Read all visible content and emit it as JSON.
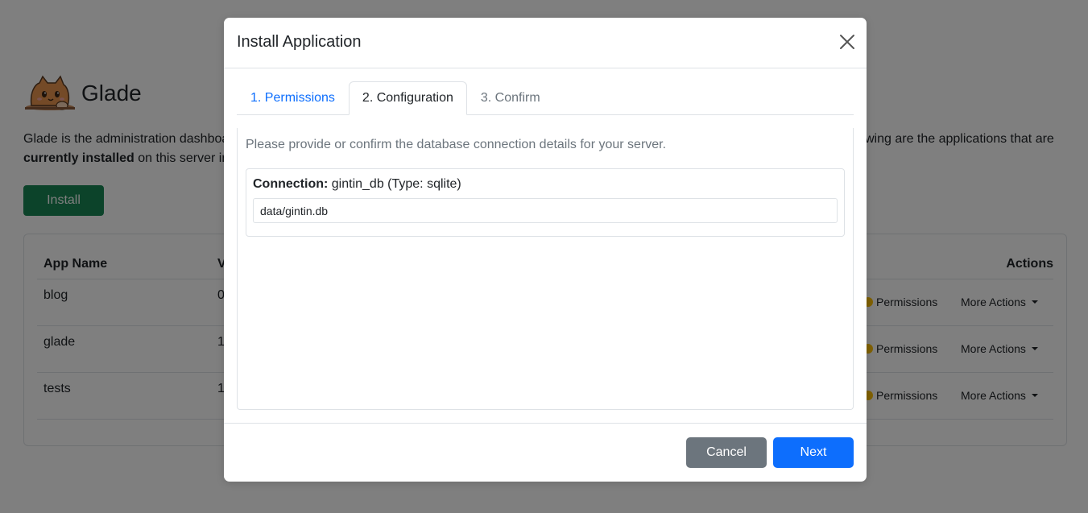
{
  "brand": {
    "title": "Glade",
    "logo_icon": "cat-logo-icon"
  },
  "intro": {
    "text_left": "Glade is the administration dashboa",
    "text_right": "wing are the applications that are",
    "bold_text": "currently installed",
    "text_line2_rest": " on this server ins"
  },
  "install_button_label": "Install",
  "apps_table": {
    "headers": {
      "name": "App Name",
      "version": "V",
      "actions": "Actions"
    },
    "rows": [
      {
        "name": "blog",
        "version": "0",
        "permissions_label": "Permissions",
        "more_label": "More Actions"
      },
      {
        "name": "glade",
        "version": "1",
        "permissions_label": "Permissions",
        "more_label": "More Actions"
      },
      {
        "name": "tests",
        "version": "1",
        "permissions_label": "Permissions",
        "more_label": "More Actions"
      }
    ]
  },
  "modal": {
    "title": "Install Application",
    "close_icon": "close-icon",
    "tabs": [
      {
        "label": "1. Permissions",
        "state": "link"
      },
      {
        "label": "2. Configuration",
        "state": "active"
      },
      {
        "label": "3. Confirm",
        "state": "disabled"
      }
    ],
    "description": "Please provide or confirm the database connection details for your server.",
    "connection": {
      "label_bold": "Connection:",
      "label_rest": " gintin_db (Type: sqlite)",
      "value": "data/gintin.db"
    },
    "footer": {
      "cancel_label": "Cancel",
      "next_label": "Next"
    }
  },
  "colors": {
    "install": "#198754",
    "cancel": "#6c757d",
    "next": "#0d6efd",
    "tab_link": "#0d6efd",
    "permission_dot": "#ffc107"
  }
}
